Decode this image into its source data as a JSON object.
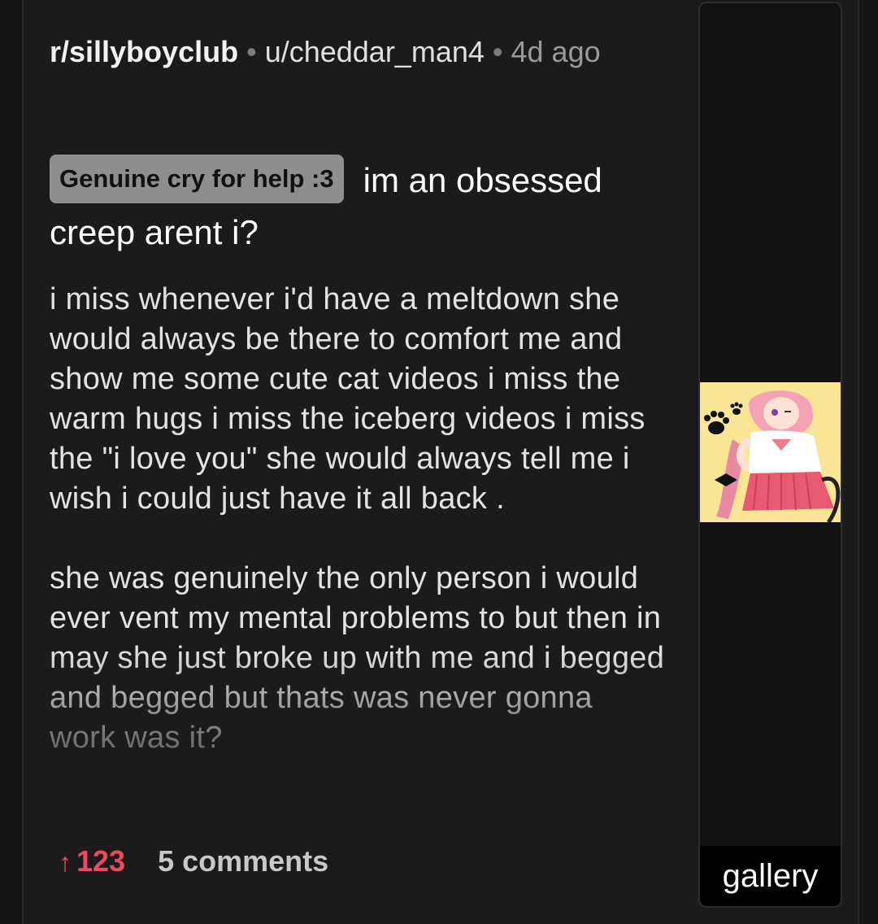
{
  "post": {
    "subreddit": "r/sillyboyclub",
    "author": "u/cheddar_man4",
    "age": "4d ago",
    "flair": "Genuine cry for help :3",
    "title": "im an obsessed creep arent i?",
    "body_paragraph_1": "i miss whenever i'd have a meltdown she would always be there to comfort me and show me some cute cat videos i miss the warm hugs i miss the iceberg videos i miss the \"i love you\" she would always tell me i wish i could just have it all back .",
    "body_paragraph_2": "she was genuinely the only person i would ever vent my mental problems to but then in may she just broke up with me and i begged and begged but thats was never gonna work was it?",
    "upvotes": "123",
    "comments": "5 comments"
  },
  "thumbnail": {
    "label": "gallery"
  },
  "colors": {
    "upvote": "#e84a5f",
    "flair_bg": "#8e8e8e",
    "background": "#1b1b1b"
  },
  "icons": {
    "upvote": "upvote-arrow-icon"
  }
}
